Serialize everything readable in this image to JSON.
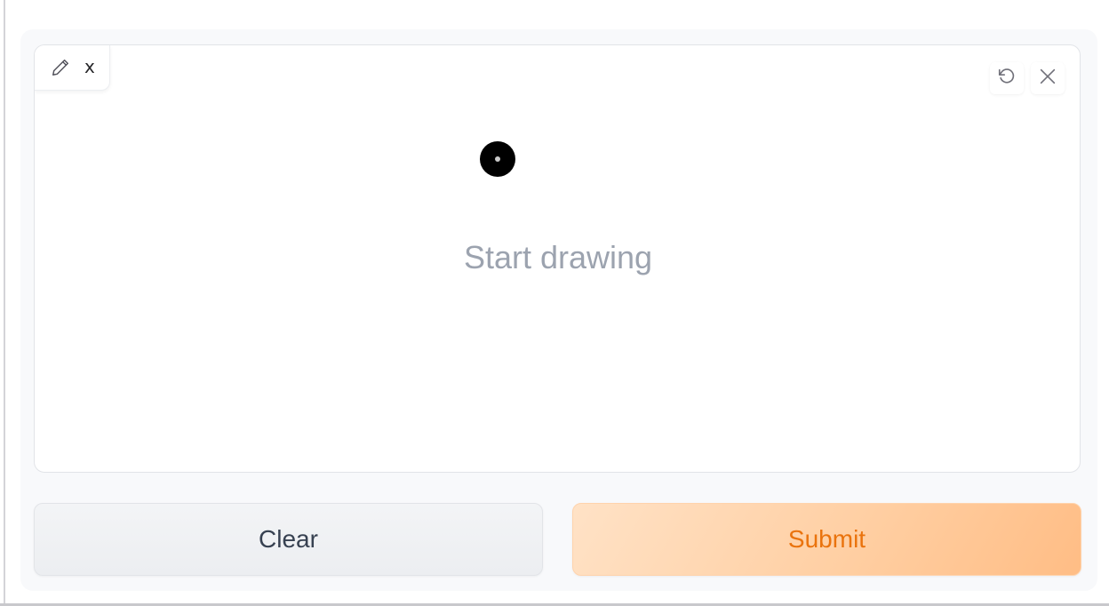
{
  "canvas": {
    "label": "x",
    "placeholder": "Start drawing",
    "icons": {
      "label_icon": "pencil-icon",
      "undo": "undo-icon",
      "close": "close-icon"
    }
  },
  "actions": {
    "clear_label": "Clear",
    "submit_label": "Submit"
  },
  "colors": {
    "accent": "#ea730d",
    "submit_bg": "#ffcfa3",
    "placeholder": "#9ca3af",
    "panel_bg": "#f8f9fb"
  }
}
